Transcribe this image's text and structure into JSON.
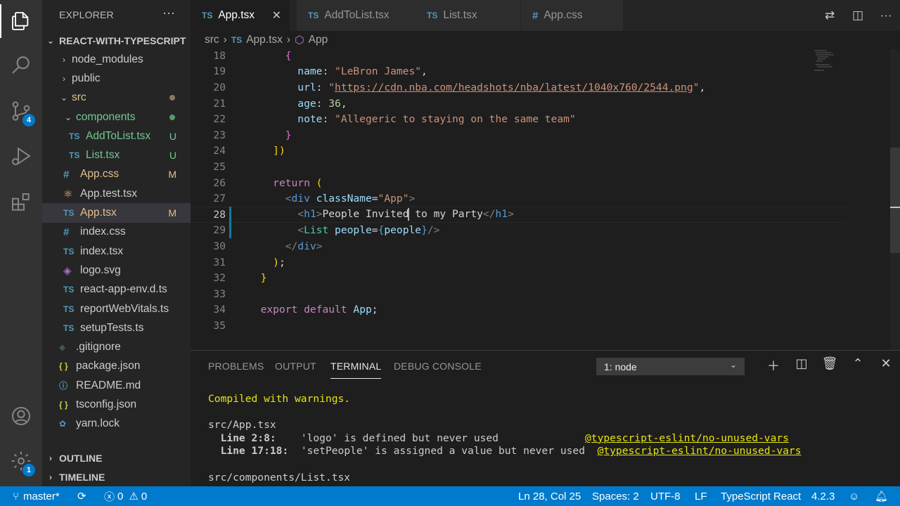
{
  "activity_bar": {
    "scm_badge": "4",
    "settings_badge": "1"
  },
  "sidebar": {
    "title": "EXPLORER",
    "more": "···",
    "project": "REACT-WITH-TYPESCRIPT",
    "outline": "OUTLINE",
    "timeline": "TIMELINE",
    "tree": [
      {
        "label": "node_modules",
        "type": "folder",
        "indent": 1,
        "expanded": false,
        "status": ""
      },
      {
        "label": "public",
        "type": "folder",
        "indent": 1,
        "expanded": false,
        "status": ""
      },
      {
        "label": "src",
        "type": "folder",
        "indent": 1,
        "expanded": true,
        "status": "dot"
      },
      {
        "label": "components",
        "type": "folder",
        "indent": 2,
        "expanded": true,
        "status": "dot-green"
      },
      {
        "label": "AddToList.tsx",
        "type": "ts",
        "indent": 3,
        "status": "U"
      },
      {
        "label": "List.tsx",
        "type": "ts",
        "indent": 3,
        "status": "U"
      },
      {
        "label": "App.css",
        "type": "css",
        "indent": 2,
        "status": "M"
      },
      {
        "label": "App.test.tsx",
        "type": "react",
        "indent": 2,
        "status": ""
      },
      {
        "label": "App.tsx",
        "type": "ts",
        "indent": 2,
        "status": "M",
        "selected": true
      },
      {
        "label": "index.css",
        "type": "css",
        "indent": 2,
        "status": ""
      },
      {
        "label": "index.tsx",
        "type": "ts",
        "indent": 2,
        "status": ""
      },
      {
        "label": "logo.svg",
        "type": "svg",
        "indent": 2,
        "status": ""
      },
      {
        "label": "react-app-env.d.ts",
        "type": "ts",
        "indent": 2,
        "status": ""
      },
      {
        "label": "reportWebVitals.ts",
        "type": "ts",
        "indent": 2,
        "status": ""
      },
      {
        "label": "setupTests.ts",
        "type": "ts",
        "indent": 2,
        "status": ""
      },
      {
        "label": ".gitignore",
        "type": "git",
        "indent": 1,
        "status": ""
      },
      {
        "label": "package.json",
        "type": "json",
        "indent": 1,
        "status": ""
      },
      {
        "label": "README.md",
        "type": "md",
        "indent": 1,
        "status": ""
      },
      {
        "label": "tsconfig.json",
        "type": "json",
        "indent": 1,
        "status": ""
      },
      {
        "label": "yarn.lock",
        "type": "yarn",
        "indent": 1,
        "status": ""
      }
    ]
  },
  "tabs": [
    {
      "label": "App.tsx",
      "icon": "TS",
      "active": true
    },
    {
      "label": "AddToList.tsx",
      "icon": "TS"
    },
    {
      "label": "List.tsx",
      "icon": "TS"
    },
    {
      "label": "App.css",
      "icon": "#"
    }
  ],
  "breadcrumb": {
    "folder": "src",
    "file_icon": "TS",
    "file": "App.tsx",
    "symbol": "App"
  },
  "editor": {
    "current_line": 28,
    "lines": [
      {
        "n": "18"
      },
      {
        "n": "19"
      },
      {
        "n": "20"
      },
      {
        "n": "21"
      },
      {
        "n": "22"
      },
      {
        "n": "23"
      },
      {
        "n": "24"
      },
      {
        "n": "25"
      },
      {
        "n": "26"
      },
      {
        "n": "27"
      },
      {
        "n": "28"
      },
      {
        "n": "29"
      },
      {
        "n": "30"
      },
      {
        "n": "31"
      },
      {
        "n": "32"
      },
      {
        "n": "33"
      },
      {
        "n": "34"
      },
      {
        "n": "35"
      }
    ],
    "code": {
      "name_key": "name",
      "name_val": "\"LeBron James\"",
      "url_key": "url",
      "url_open": "\"",
      "url_val": "https://cdn.nba.com/headshots/nba/latest/1040x760/2544.png",
      "url_close": "\"",
      "age_key": "age",
      "age_val": "36",
      "note_key": "note",
      "note_val": "\"Allegeric to staying on the same team\"",
      "return_kw": "return",
      "div_tag": "div",
      "classname_attr": "className",
      "classname_val": "\"App\"",
      "h1_tag": "h1",
      "h1_text_a": "People Invited",
      "h1_text_b": " to my Party",
      "list_tag": "List",
      "people_attr": "people",
      "people_var": "people",
      "export_kw": "export",
      "default_kw": "default",
      "app_name": "App"
    }
  },
  "panel": {
    "tabs": [
      "PROBLEMS",
      "OUTPUT",
      "TERMINAL",
      "DEBUG CONSOLE"
    ],
    "active_tab": "TERMINAL",
    "terminal_select": "1: node",
    "terminal": {
      "compiled": "Compiled with warnings.",
      "file1": "src/App.tsx",
      "w1_loc": "Line 2:8:",
      "w1_msg": "'logo' is defined but never used",
      "w1_rule": "@typescript-eslint/no-unused-vars",
      "w2_loc": "Line 17:18:",
      "w2_msg": "'setPeople' is assigned a value but never used",
      "w2_rule": "@typescript-eslint/no-unused-vars",
      "file2": "src/components/List.tsx"
    }
  },
  "statusbar": {
    "branch": "master*",
    "errors": "0",
    "warnings": "0",
    "position": "Ln 28, Col 25",
    "spaces": "Spaces: 2",
    "encoding": "UTF-8",
    "eol": "LF",
    "language": "TypeScript React",
    "version": "4.2.3"
  }
}
